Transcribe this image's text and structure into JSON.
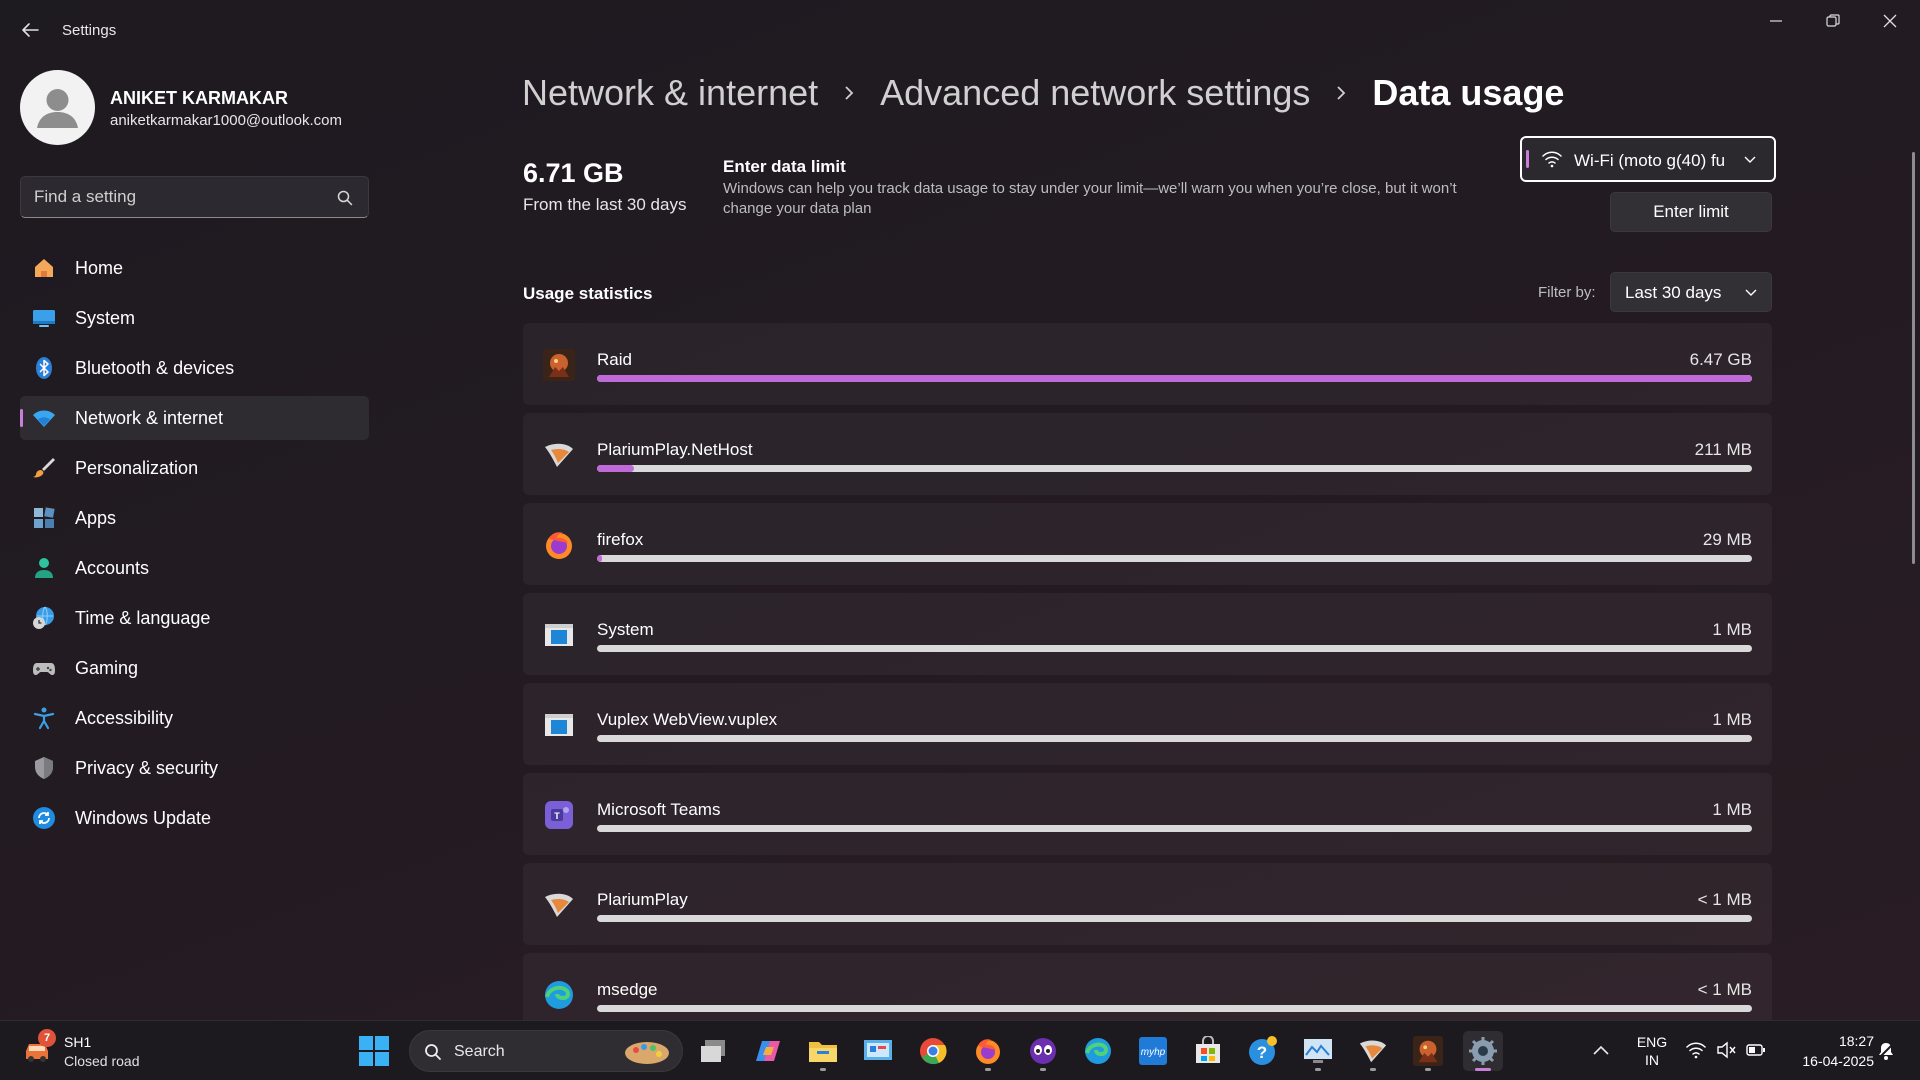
{
  "window": {
    "title": "Settings"
  },
  "profile": {
    "name": "ANIKET KARMAKAR",
    "email": "aniketkarmakar1000@outlook.com"
  },
  "search": {
    "placeholder": "Find a setting"
  },
  "nav": {
    "items": [
      {
        "label": "Home",
        "icon": "home-icon",
        "active": false
      },
      {
        "label": "System",
        "icon": "system-icon",
        "active": false
      },
      {
        "label": "Bluetooth & devices",
        "icon": "bluetooth-icon",
        "active": false
      },
      {
        "label": "Network & internet",
        "icon": "wifi-icon",
        "active": true
      },
      {
        "label": "Personalization",
        "icon": "brush-icon",
        "active": false
      },
      {
        "label": "Apps",
        "icon": "apps-icon",
        "active": false
      },
      {
        "label": "Accounts",
        "icon": "accounts-icon",
        "active": false
      },
      {
        "label": "Time & language",
        "icon": "globe-clock-icon",
        "active": false
      },
      {
        "label": "Gaming",
        "icon": "gamepad-icon",
        "active": false
      },
      {
        "label": "Accessibility",
        "icon": "accessibility-icon",
        "active": false
      },
      {
        "label": "Privacy & security",
        "icon": "shield-icon",
        "active": false
      },
      {
        "label": "Windows Update",
        "icon": "update-icon",
        "active": false
      }
    ]
  },
  "breadcrumb": {
    "items": [
      "Network & internet",
      "Advanced network settings",
      "Data usage"
    ]
  },
  "summary": {
    "total": "6.71 GB",
    "period": "From the last 30 days"
  },
  "data_limit": {
    "title": "Enter data limit",
    "description": "Windows can help you track data usage to stay under your limit—we’ll warn you when you’re close, but it won’t change your data plan",
    "button_label": "Enter limit"
  },
  "network_selector": {
    "value": "Wi-Fi (moto g(40) fu"
  },
  "usage": {
    "title": "Usage statistics",
    "filter_label": "Filter by:",
    "filter_value": "Last 30 days",
    "rows": [
      {
        "name": "Raid",
        "amount": "6.47 GB",
        "fraction": 1.0,
        "icon": "raid-app-icon"
      },
      {
        "name": "PlariumPlay.NetHost",
        "amount": "211 MB",
        "fraction": 0.032,
        "icon": "plarium-app-icon"
      },
      {
        "name": "firefox",
        "amount": "29 MB",
        "fraction": 0.004,
        "icon": "firefox-app-icon"
      },
      {
        "name": "System",
        "amount": "1 MB",
        "fraction": 0.0,
        "icon": "system-app-icon"
      },
      {
        "name": "Vuplex WebView.vuplex",
        "amount": "1 MB",
        "fraction": 0.0,
        "icon": "vuplex-app-icon"
      },
      {
        "name": "Microsoft Teams",
        "amount": "1 MB",
        "fraction": 0.0,
        "icon": "teams-app-icon"
      },
      {
        "name": "PlariumPlay",
        "amount": "< 1 MB",
        "fraction": 0.0,
        "icon": "plarium-app-icon"
      },
      {
        "name": "msedge",
        "amount": "< 1 MB",
        "fraction": 0.0,
        "icon": "edge-app-icon"
      }
    ]
  },
  "taskbar": {
    "weather_badge": "7",
    "weather_title": "SH1",
    "weather_subtitle": "Closed road",
    "search_label": "Search",
    "apps": [
      "task-view-icon",
      "copilot-icon",
      "file-explorer-icon",
      "control-panel-icon",
      "chrome-icon",
      "firefox-icon",
      "game-icon",
      "edge-icon",
      "myhp-icon",
      "microsoft-store-icon",
      "get-help-icon",
      "monitor-icon",
      "plarium-icon",
      "raid-icon",
      "settings-icon"
    ],
    "lang_line1": "ENG",
    "lang_line2": "IN",
    "time": "18:27",
    "date": "16-04-2025"
  },
  "colors": {
    "accent": "#c87fd8",
    "bar_fill": "#bf6ad8",
    "bar_track": "#d9d9d9"
  }
}
